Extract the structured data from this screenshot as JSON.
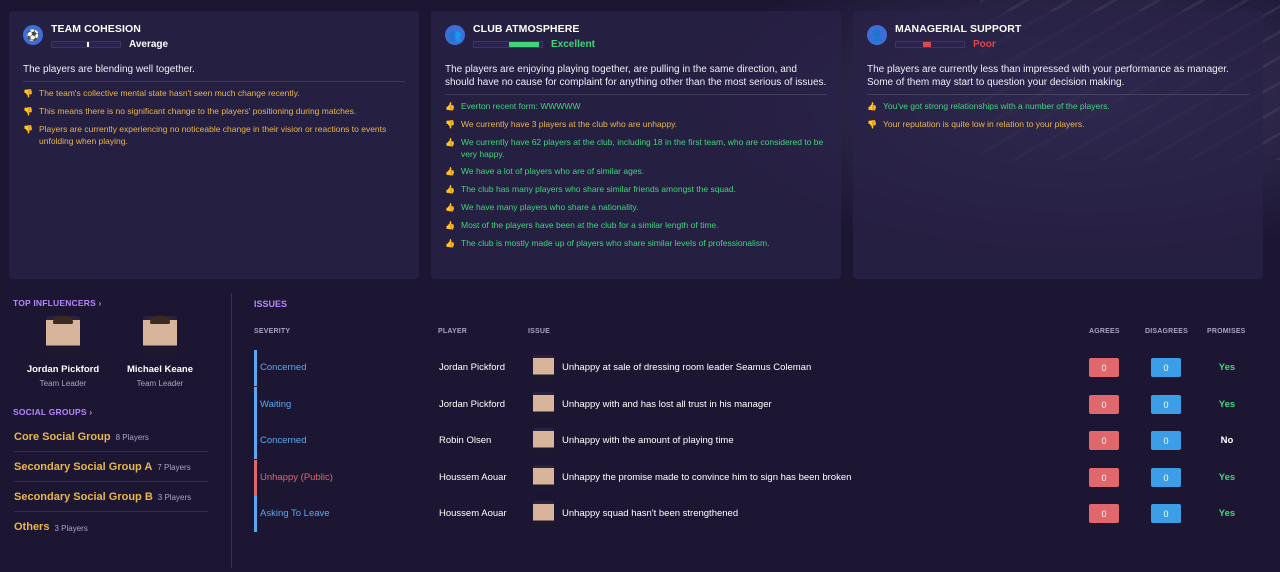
{
  "panels": [
    {
      "title": "TEAM COHESION",
      "icon": "football-icon",
      "meter_label": "Average",
      "meter_color": "#ffffff",
      "meter_level": 0.5,
      "summary": "The players are blending well together.",
      "facts": [
        {
          "tone": "bad",
          "text": "The team's collective mental state hasn't seen much change recently."
        },
        {
          "tone": "bad",
          "text": "This means there is no significant change to the players' positioning during matches."
        },
        {
          "tone": "bad",
          "text": "Players are currently experiencing no noticeable change in their vision or reactions to events unfolding when playing."
        }
      ]
    },
    {
      "title": "CLUB ATMOSPHERE",
      "icon": "people-icon",
      "meter_label": "Excellent",
      "meter_color": "#3fd67b",
      "meter_level": 0.9,
      "summary": "The players are enjoying playing together, are pulling in the same direction, and should have no cause for complaint for anything other than the most serious of issues.",
      "facts": [
        {
          "tone": "good",
          "text": "Everton recent form: WWWWW"
        },
        {
          "tone": "bad",
          "text": "We currently have 3 players at the club who are unhappy."
        },
        {
          "tone": "good",
          "text": "We currently have 62 players at the club, including 18 in the first team, who are considered to be very happy."
        },
        {
          "tone": "good",
          "text": "We have a lot of players who are of similar ages."
        },
        {
          "tone": "good",
          "text": "The club has many players who share similar friends amongst the squad."
        },
        {
          "tone": "good",
          "text": "We have many players who share a nationality."
        },
        {
          "tone": "good",
          "text": "Most of the players have been at the club for a similar length of time."
        },
        {
          "tone": "good",
          "text": "The club is mostly made up of players who share similar levels of professionalism."
        }
      ]
    },
    {
      "title": "MANAGERIAL SUPPORT",
      "icon": "manager-icon",
      "meter_label": "Poor",
      "meter_color": "#e0474b",
      "meter_level": 0.25,
      "summary": "The players are currently less than impressed with your performance as manager. Some of them may start to question your decision making.",
      "facts": [
        {
          "tone": "good",
          "text": "You've got strong relationships with a number of the players."
        },
        {
          "tone": "bad",
          "text": "Your reputation is quite low in relation to your players."
        }
      ]
    }
  ],
  "top_influencers": {
    "label": "TOP INFLUENCERS ›",
    "people": [
      {
        "name": "Jordan Pickford",
        "role": "Team Leader"
      },
      {
        "name": "Michael Keane",
        "role": "Team Leader"
      }
    ]
  },
  "social_groups": {
    "label": "SOCIAL GROUPS ›",
    "groups": [
      {
        "name": "Core Social Group",
        "count": "8 Players"
      },
      {
        "name": "Secondary Social Group A",
        "count": "7 Players"
      },
      {
        "name": "Secondary Social Group B",
        "count": "3 Players"
      },
      {
        "name": "Others",
        "count": "3 Players"
      }
    ]
  },
  "issues": {
    "title": "ISSUES",
    "headers": {
      "severity": "SEVERITY",
      "player": "PLAYER",
      "issue": "ISSUE",
      "agrees": "AGREES",
      "disagrees": "DISAGREES",
      "promises": "PROMISES"
    },
    "rows": [
      {
        "severity": "Concerned",
        "severity_color": "#5aa8f0",
        "player": "Jordan Pickford",
        "issue": "Unhappy at sale of dressing room leader Seamus Coleman",
        "agrees": "0",
        "disagrees": "0",
        "promise": "Yes",
        "promise_color": "#3fd67b"
      },
      {
        "severity": "Waiting",
        "severity_color": "#5aa8f0",
        "player": "Jordan Pickford",
        "issue": "Unhappy with and has lost all trust in his manager",
        "agrees": "0",
        "disagrees": "0",
        "promise": "Yes",
        "promise_color": "#3fd67b"
      },
      {
        "severity": "Concerned",
        "severity_color": "#5aa8f0",
        "player": "Robin Olsen",
        "issue": "Unhappy with the amount of playing time",
        "agrees": "0",
        "disagrees": "0",
        "promise": "No",
        "promise_color": "#ffffff"
      },
      {
        "severity": "Unhappy (Public)",
        "severity_color": "#e0676b",
        "player": "Houssem Aouar",
        "issue": "Unhappy the promise made to convince him to sign has been broken",
        "agrees": "0",
        "disagrees": "0",
        "promise": "Yes",
        "promise_color": "#3fd67b"
      },
      {
        "severity": "Asking To Leave",
        "severity_color": "#5aa8f0",
        "player": "Houssem Aouar",
        "issue": "Unhappy squad hasn't been strengthened",
        "agrees": "0",
        "disagrees": "0",
        "promise": "Yes",
        "promise_color": "#3fd67b"
      }
    ]
  }
}
